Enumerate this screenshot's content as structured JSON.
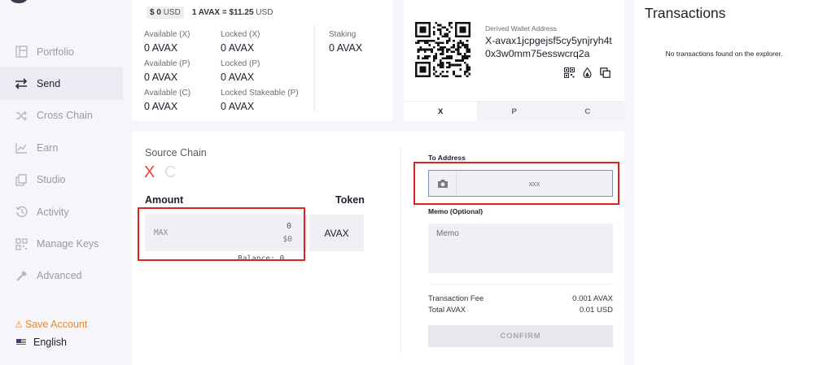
{
  "sidebar": {
    "items": [
      {
        "label": "Portfolio",
        "icon": "portfolio-icon",
        "active": false
      },
      {
        "label": "Send",
        "icon": "send-icon",
        "active": true
      },
      {
        "label": "Cross Chain",
        "icon": "cross-chain-icon",
        "active": false
      },
      {
        "label": "Earn",
        "icon": "earn-icon",
        "active": false
      },
      {
        "label": "Studio",
        "icon": "studio-icon",
        "active": false
      },
      {
        "label": "Activity",
        "icon": "activity-icon",
        "active": false
      },
      {
        "label": "Manage Keys",
        "icon": "manage-keys-icon",
        "active": false
      },
      {
        "label": "Advanced",
        "icon": "advanced-icon",
        "active": false
      }
    ],
    "save_account": "Save Account",
    "language": "English"
  },
  "balance": {
    "usd_value": "$ 0",
    "usd_unit": "USD",
    "rate_prefix": "1 AVAX = ",
    "rate_value": "$11.25",
    "rate_unit": " USD",
    "available_x_label": "Available (X)",
    "available_x_value": "0 AVAX",
    "available_p_label": "Available (P)",
    "available_p_value": "0 AVAX",
    "available_c_label": "Available (C)",
    "available_c_value": "0 AVAX",
    "locked_x_label": "Locked (X)",
    "locked_x_value": "0 AVAX",
    "locked_p_label": "Locked (P)",
    "locked_p_value": "0 AVAX",
    "locked_stakeable_label": "Locked Stakeable (P)",
    "locked_stakeable_value": "0 AVAX",
    "staking_label": "Staking",
    "staking_value": "0 AVAX"
  },
  "wallet": {
    "address_label": "Derived Wallet Address",
    "address": "X-avax1jcpgejsf5cy5ynjryh4t0x3w0mm75esswcrq2a",
    "tabs": [
      "X",
      "P",
      "C"
    ],
    "active_tab": "X"
  },
  "send_form": {
    "source_chain_label": "Source Chain",
    "chains": [
      "X",
      "C"
    ],
    "selected_chain": "X",
    "amount_label": "Amount",
    "token_label": "Token",
    "max_label": "MAX",
    "amount_value": "0",
    "amount_usd": "$0",
    "token": "AVAX",
    "balance_text": "Balance: 0",
    "to_address_label": "To Address",
    "to_address_placeholder": "xxx",
    "memo_label": "Memo (Optional)",
    "memo_placeholder": "Memo",
    "fee_label": "Transaction Fee",
    "fee_value": "0.001 AVAX",
    "total_label": "Total AVAX",
    "total_value": "0.01 USD",
    "confirm_label": "CONFIRM"
  },
  "transactions": {
    "title": "Transactions",
    "empty_message": "No transactions found on the explorer."
  },
  "colors": {
    "accent_red": "#e84142",
    "highlight_red": "#e01f1f",
    "warning_orange": "#e68a2e"
  }
}
